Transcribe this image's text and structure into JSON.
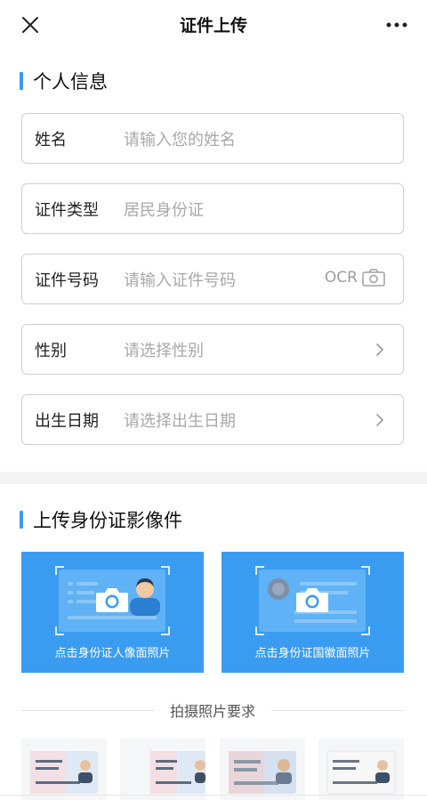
{
  "nav": {
    "title": "证件上传"
  },
  "personal": {
    "section_title": "个人信息",
    "fields": [
      {
        "label": "姓名",
        "value": "请输入您的姓名"
      },
      {
        "label": "证件类型",
        "value": "居民身份证"
      },
      {
        "label": "证件号码",
        "value": "请输入证件号码",
        "ocr": "OCR"
      },
      {
        "label": "性别",
        "value": "请选择性别"
      },
      {
        "label": "出生日期",
        "value": "请选择出生日期"
      }
    ]
  },
  "upload": {
    "section_title": "上传身份证影像件",
    "front_caption": "点击身份证人像面照片",
    "back_caption": "点击身份证国徽面照片",
    "requirements_title": "拍摄照片要求"
  },
  "colors": {
    "accent": "#3a98f0",
    "upload_bg": "#3a9cf0"
  }
}
